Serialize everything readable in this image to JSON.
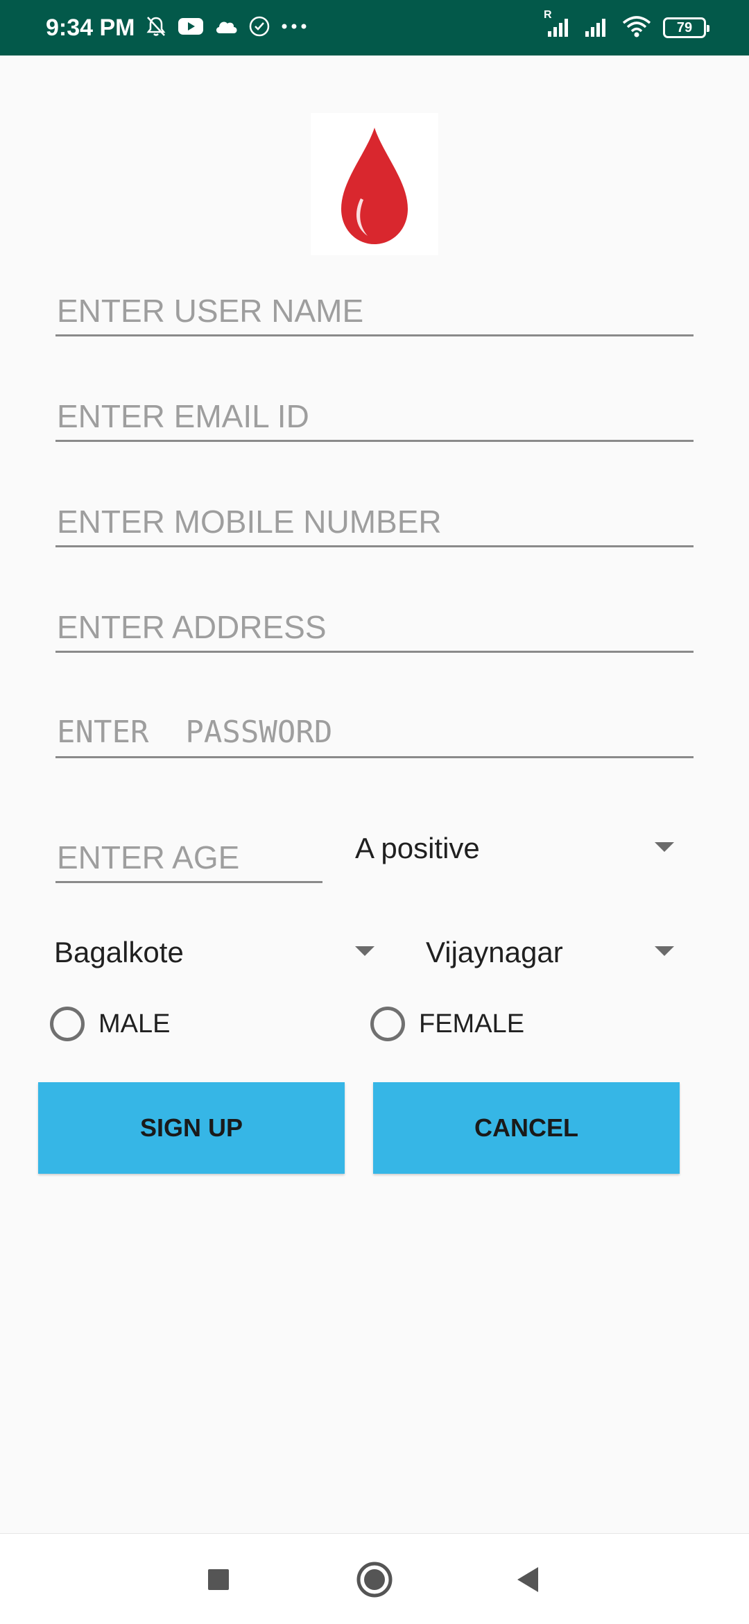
{
  "status_bar": {
    "time": "9:34 PM",
    "battery": "79",
    "network_label": "R",
    "icons_left": [
      "bell-muted-icon",
      "youtube-icon",
      "cloud-icon",
      "check-circle-icon",
      "more-dots-icon"
    ],
    "icons_right": [
      "signal-roaming-icon",
      "signal-icon",
      "wifi-icon",
      "battery-icon"
    ]
  },
  "logo": {
    "icon": "blood-drop-icon",
    "color": "#d9272e"
  },
  "form": {
    "username_placeholder": "ENTER USER NAME",
    "email_placeholder": "ENTER EMAIL ID",
    "mobile_placeholder": "ENTER MOBILE NUMBER",
    "address_placeholder": "ENTER ADDRESS",
    "password_placeholder": "ENTER  PASSWORD",
    "age_placeholder": "ENTER AGE",
    "blood_group_selected": "A positive",
    "district_selected": "Bagalkote",
    "city_selected": "Vijaynagar",
    "gender_options": [
      "MALE",
      "FEMALE"
    ]
  },
  "buttons": {
    "signup_label": "SIGN UP",
    "cancel_label": "CANCEL"
  },
  "colors": {
    "status_bar": "#03594a",
    "button": "#36b6e6",
    "background": "#fafafa"
  },
  "nav_bar": {
    "icons": [
      "recents-square-icon",
      "home-circle-icon",
      "back-triangle-icon"
    ]
  }
}
